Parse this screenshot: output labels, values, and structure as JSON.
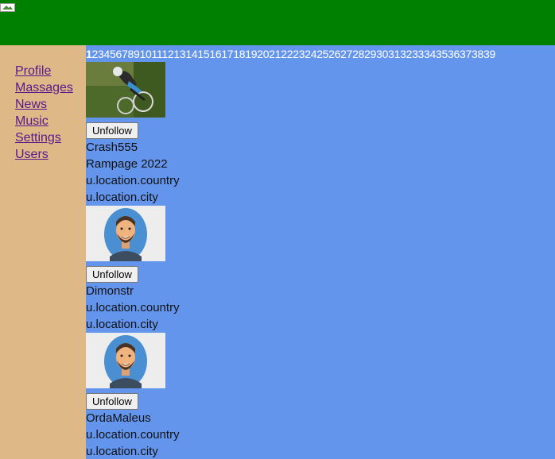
{
  "header": {
    "logo_alt": "logo"
  },
  "sidebar": {
    "items": [
      {
        "label": "Profile"
      },
      {
        "label": "Massages"
      },
      {
        "label": "News"
      },
      {
        "label": "Music"
      },
      {
        "label": "Settings"
      },
      {
        "label": "Users"
      }
    ]
  },
  "pager": {
    "current": 1,
    "pages": [
      "1",
      "2",
      "3",
      "4",
      "5",
      "6",
      "7",
      "8",
      "9",
      "10",
      "11",
      "12",
      "13",
      "14",
      "15",
      "16",
      "17",
      "18",
      "19",
      "20",
      "21",
      "22",
      "23",
      "24",
      "25",
      "26",
      "27",
      "28",
      "29",
      "30",
      "31",
      "32",
      "33",
      "34",
      "35",
      "36",
      "37",
      "38",
      "39"
    ]
  },
  "users": [
    {
      "name": "Crash555",
      "status": "Rampage 2022",
      "country": "u.location.country",
      "city": "u.location.city",
      "button": "Unfollow",
      "avatar": "bike-photo"
    },
    {
      "name": "Dimonstr",
      "status": "",
      "country": "u.location.country",
      "city": "u.location.city",
      "button": "Unfollow",
      "avatar": "cartoon-man"
    },
    {
      "name": "OrdaMaleus",
      "status": "",
      "country": "u.location.country",
      "city": "u.location.city",
      "button": "Unfollow",
      "avatar": "cartoon-man"
    }
  ]
}
